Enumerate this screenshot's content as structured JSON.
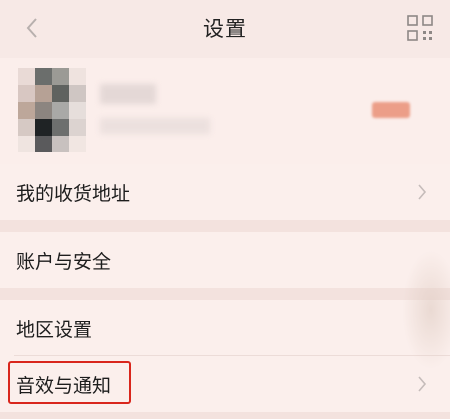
{
  "header": {
    "title": "设置",
    "back_icon": "chevron-left-icon",
    "qr_icon": "qr-code-icon"
  },
  "profile": {
    "avatar_icon": "avatar-pixelated"
  },
  "menu": {
    "items": [
      {
        "label": "我的收货地址",
        "has_arrow": true
      },
      {
        "label": "账户与安全",
        "has_arrow": false
      },
      {
        "label": "地区设置",
        "has_arrow": false
      },
      {
        "label": "音效与通知",
        "has_arrow": true
      }
    ]
  },
  "colors": {
    "background": "#f7e9e6",
    "row_background": "#fbefec",
    "highlight": "#d9261c",
    "badge": "#ec9e88",
    "icon_gray": "#b8b0ae"
  }
}
